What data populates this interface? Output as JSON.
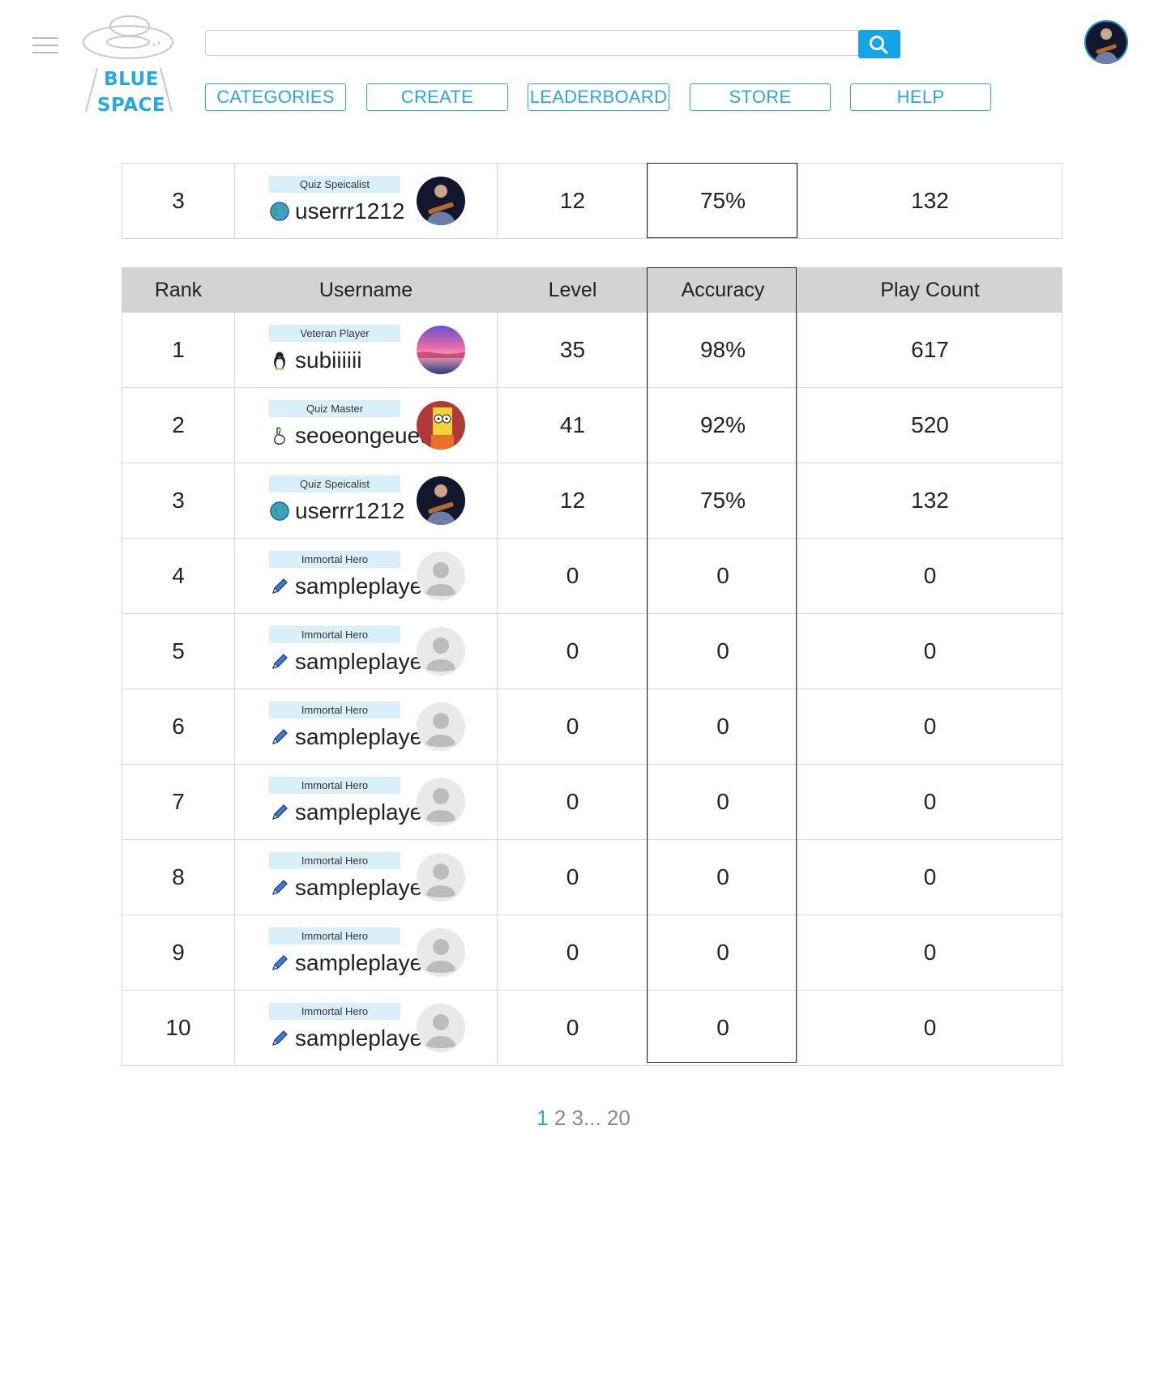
{
  "header": {
    "logo_line1": "BLUE",
    "logo_line2": "SPACE",
    "search": {
      "value": "",
      "placeholder": ""
    },
    "nav": [
      "CATEGORIES",
      "CREATE",
      "LEADERBOARD",
      "STORE",
      "HELP"
    ]
  },
  "colors": {
    "accent": "#2aa7df",
    "badge_bg": "#d9f0fb",
    "header_bg": "#d3d3d3"
  },
  "my_rank": {
    "rank": "3",
    "title": "Quiz Speicalist",
    "icon": "globe-icon",
    "username": "userrr1212",
    "avatar": "guitarist-avatar",
    "level": "12",
    "accuracy": "75%",
    "play_count": "132"
  },
  "leaderboard": {
    "headers": {
      "rank": "Rank",
      "username": "Username",
      "level": "Level",
      "accuracy": "Accuracy",
      "play_count": "Play Count"
    },
    "rows": [
      {
        "rank": "1",
        "title": "Veteran Player",
        "icon": "penguin-icon",
        "emoji": "🐧",
        "username": "subiiiiii",
        "avatar": "sunset-avatar",
        "level": "35",
        "accuracy": "98%",
        "play_count": "617"
      },
      {
        "rank": "2",
        "title": "Quiz Master",
        "icon": "goose-icon",
        "emoji": "🪿",
        "username": "seoeongeueun",
        "avatar": "cartoon-avatar",
        "level": "41",
        "accuracy": "92%",
        "play_count": "520"
      },
      {
        "rank": "3",
        "title": "Quiz Speicalist",
        "icon": "globe-icon",
        "emoji": "🌏",
        "username": "userrr1212",
        "avatar": "guitarist-avatar",
        "level": "12",
        "accuracy": "75%",
        "play_count": "132"
      },
      {
        "rank": "4",
        "title": "Immortal Hero",
        "icon": "pen-icon",
        "emoji": "🖊",
        "username": "sampleplayer",
        "avatar": "default-avatar",
        "level": "0",
        "accuracy": "0",
        "play_count": "0"
      },
      {
        "rank": "5",
        "title": "Immortal Hero",
        "icon": "pen-icon",
        "emoji": "🖊",
        "username": "sampleplayer",
        "avatar": "default-avatar",
        "level": "0",
        "accuracy": "0",
        "play_count": "0"
      },
      {
        "rank": "6",
        "title": "Immortal Hero",
        "icon": "pen-icon",
        "emoji": "🖊",
        "username": "sampleplayer",
        "avatar": "default-avatar",
        "level": "0",
        "accuracy": "0",
        "play_count": "0"
      },
      {
        "rank": "7",
        "title": "Immortal Hero",
        "icon": "pen-icon",
        "emoji": "🖊",
        "username": "sampleplayer",
        "avatar": "default-avatar",
        "level": "0",
        "accuracy": "0",
        "play_count": "0"
      },
      {
        "rank": "8",
        "title": "Immortal Hero",
        "icon": "pen-icon",
        "emoji": "🖊",
        "username": "sampleplayer",
        "avatar": "default-avatar",
        "level": "0",
        "accuracy": "0",
        "play_count": "0"
      },
      {
        "rank": "9",
        "title": "Immortal Hero",
        "icon": "pen-icon",
        "emoji": "🖊",
        "username": "sampleplayer",
        "avatar": "default-avatar",
        "level": "0",
        "accuracy": "0",
        "play_count": "0"
      },
      {
        "rank": "10",
        "title": "Immortal Hero",
        "icon": "pen-icon",
        "emoji": "🖊",
        "username": "sampleplayer",
        "avatar": "default-avatar",
        "level": "0",
        "accuracy": "0",
        "play_count": "0"
      }
    ]
  },
  "pagination": {
    "pages": [
      "1",
      "2",
      "3",
      "...",
      "20"
    ],
    "current": "1"
  }
}
